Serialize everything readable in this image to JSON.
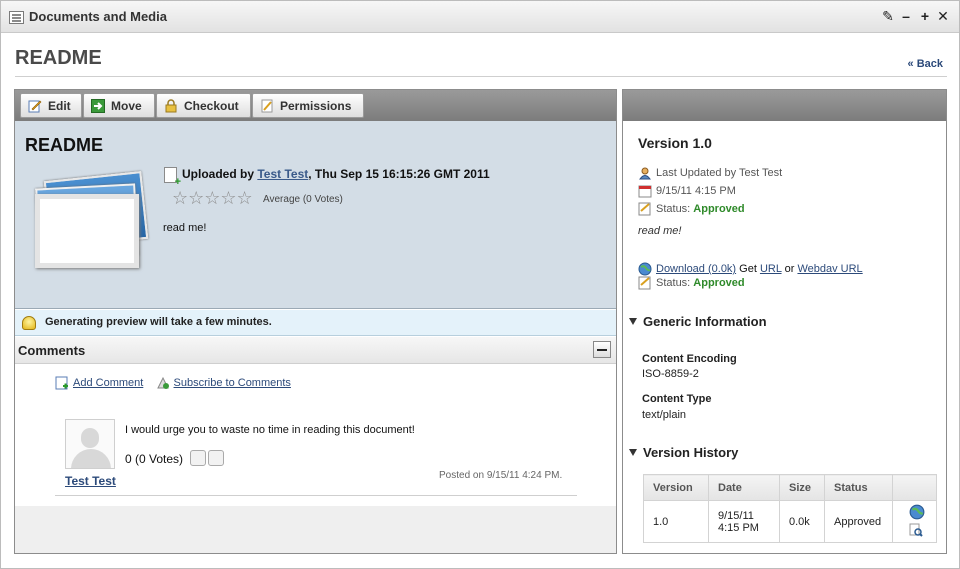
{
  "window": {
    "title": "Documents and Media",
    "controls": [
      "✎",
      "–",
      "+",
      "✕"
    ]
  },
  "heading": "README",
  "back_link": "« Back",
  "toolbar": {
    "edit": "Edit",
    "move": "Move",
    "checkout": "Checkout",
    "permissions": "Permissions"
  },
  "document": {
    "title": "README",
    "uploaded_prefix": "Uploaded by ",
    "uploader": "Test Test",
    "uploaded_suffix": ", Thu Sep 15 16:15:26 GMT 2011",
    "stars": "☆☆☆☆☆",
    "rating_text": "Average (0 Votes)",
    "description": "read me!"
  },
  "preview": {
    "message": "Generating preview will take a few minutes."
  },
  "comments": {
    "title": "Comments",
    "add_comment": "Add Comment",
    "subscribe": "Subscribe to Comments",
    "items": [
      {
        "body": "I would urge you to waste no time in reading this document!",
        "votes": "0 (0 Votes)",
        "author": "Test Test",
        "posted": "Posted on 9/15/11 4:24 PM."
      }
    ]
  },
  "version": {
    "title": "Version 1.0",
    "last_updated": "Last Updated by Test Test",
    "date": "9/15/11 4:15 PM",
    "status_label": "Status: ",
    "status_value": "Approved",
    "description": "read me!",
    "download": "Download (0.0k)",
    "get": " Get ",
    "url": "URL",
    "or": " or ",
    "webdav": "Webdav URL",
    "status2_label": "Status: ",
    "status2_value": "Approved"
  },
  "generic_info": {
    "title": "Generic Information",
    "content_encoding_label": "Content Encoding",
    "content_encoding_value": "ISO-8859-2",
    "content_type_label": "Content Type",
    "content_type_value": "text/plain"
  },
  "version_history": {
    "title": "Version History",
    "headers": [
      "Version",
      "Date",
      "Size",
      "Status",
      ""
    ],
    "rows": [
      {
        "version": "1.0",
        "date_line1": "9/15/11",
        "date_line2": "4:15 PM",
        "size": "0.0k",
        "status": "Approved"
      }
    ]
  },
  "colors": {
    "approved": "#2f8a2a",
    "link": "#2c4a7a",
    "toolbar": "#8a8a8a",
    "doc_bg": "#d3dde6"
  }
}
